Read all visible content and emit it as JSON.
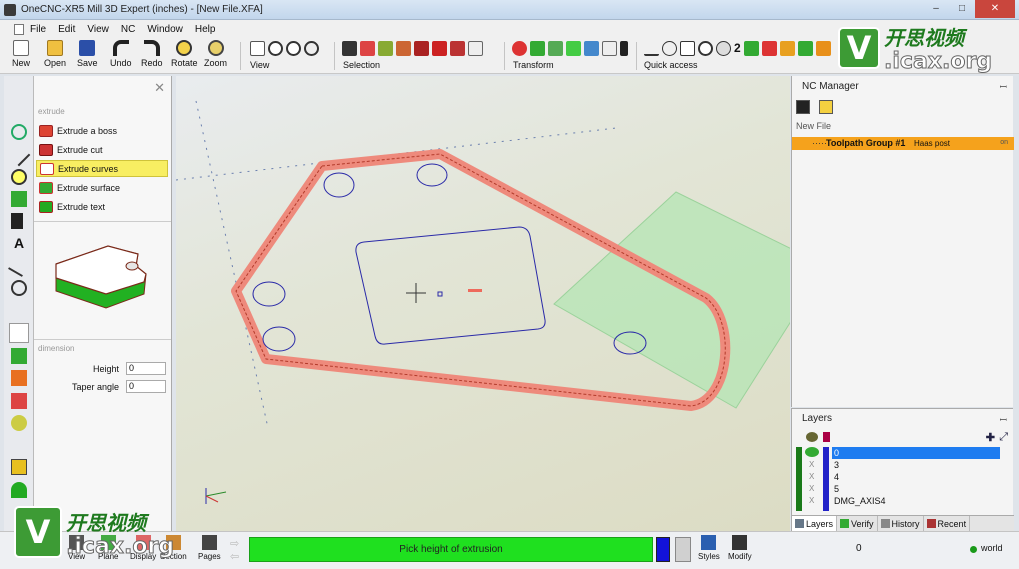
{
  "window": {
    "title": "OneCNC-XR5 Mill 3D Expert (inches) - [New File.XFA]",
    "controls": [
      "–",
      "□",
      "✕"
    ]
  },
  "menu": {
    "items": [
      "File",
      "Edit",
      "View",
      "NC",
      "Window",
      "Help"
    ],
    "mdi_controls": "– ▫ ✕"
  },
  "toolbar": {
    "buttons": [
      "New",
      "Open",
      "Save",
      "Undo",
      "Redo",
      "Rotate",
      "Zoom",
      "View"
    ],
    "groups": {
      "selection": "Selection",
      "transform": "Transform",
      "quick_access": "Quick access"
    },
    "counter": "2"
  },
  "watermark": {
    "cn": "开思视频",
    "en": ".icax.org"
  },
  "extrude_panel": {
    "close": "✕",
    "section": "extrude",
    "items": [
      "Extrude a boss",
      "Extrude cut",
      "Extrude curves",
      "Extrude surface",
      "Extrude text"
    ],
    "selected_item": "Extrude curves",
    "dimension_section": "dimension",
    "height_label": "Height",
    "height_value": "0",
    "taper_label": "Taper angle",
    "taper_value": "0"
  },
  "nc_manager": {
    "title": "NC Manager",
    "file": "New File",
    "group": "Toolpath Group #1",
    "post": "Haas post",
    "status": "on"
  },
  "layers": {
    "title": "Layers",
    "rows": [
      "0",
      "3",
      "4",
      "5",
      "DMG_AXIS4"
    ],
    "hidden_marks": [
      "X",
      "X",
      "X",
      "X"
    ],
    "tabs": [
      "Layers",
      "Verify",
      "History",
      "Recent"
    ]
  },
  "statusbar": {
    "buttons": [
      "View",
      "Plane",
      "Display",
      "Section",
      "Pages"
    ],
    "right_buttons": [
      "Styles",
      "Modify"
    ],
    "prompt": "Pick height of extrusion",
    "value": "0",
    "coord": "world"
  },
  "colors": {
    "prompt": "#1fe01f",
    "selected_item": "#f8ee62",
    "toolpath_row": "#f5a21c",
    "layer_selected": "#1e7cf0",
    "extrude_outline": "#e8766a",
    "plane": "#b4e6b4"
  }
}
